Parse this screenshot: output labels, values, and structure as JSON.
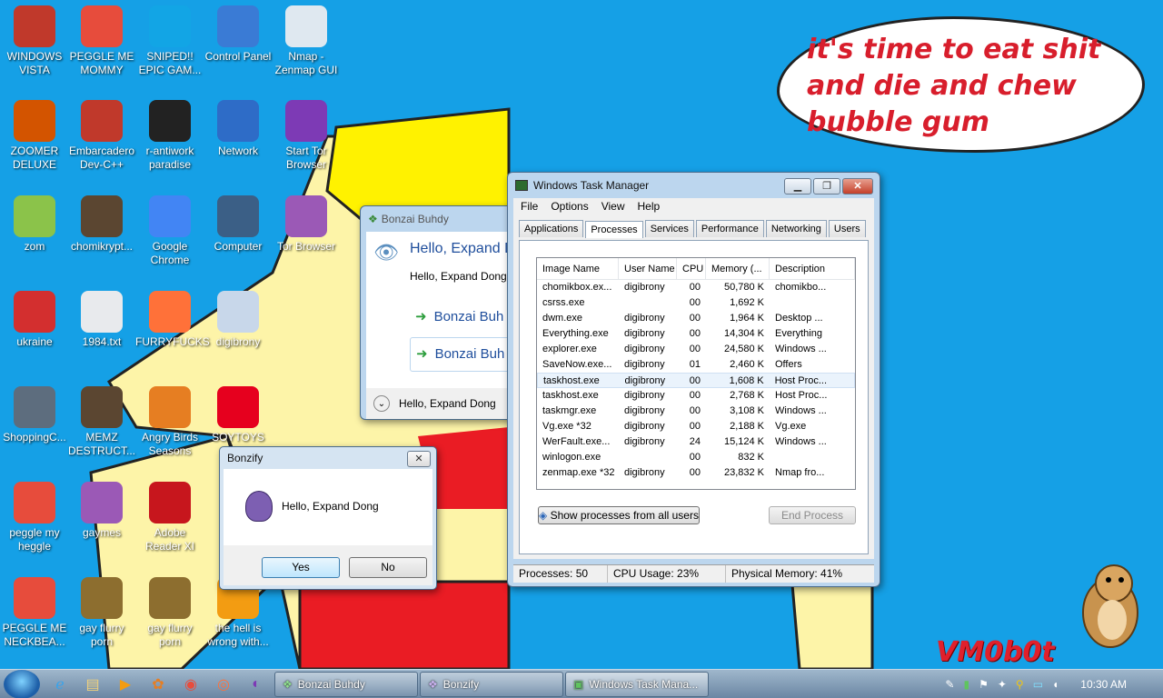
{
  "speech_text": "it's time to eat shit and die and chew bubble gum",
  "watermark": "VM0b0t",
  "desktop_icons": [
    {
      "label": "WINDOWS VISTA",
      "icon": "vista-icon",
      "color": "#c0392b"
    },
    {
      "label": "PEGGLE ME MOMMY",
      "icon": "peggle-icon",
      "color": "#e74c3c"
    },
    {
      "label": "SNIPED!! EPIC GAM...",
      "icon": "skype-icon",
      "color": "#12a5e5"
    },
    {
      "label": "Control Panel",
      "icon": "control-panel-icon",
      "color": "#3a7bd5"
    },
    {
      "label": "Nmap - Zenmap GUI",
      "icon": "eye-icon",
      "color": "#dfe8f0"
    },
    {
      "label": "ZOOMER DELUXE",
      "icon": "zoomer-icon",
      "color": "#d35400"
    },
    {
      "label": "Embarcadero Dev-C++",
      "icon": "devcpp-icon",
      "color": "#c0392b"
    },
    {
      "label": "r-antiwork paradise",
      "icon": "reddit-icon",
      "color": "#222222"
    },
    {
      "label": "Network",
      "icon": "network-icon",
      "color": "#2e6cc7"
    },
    {
      "label": "Start Tor Browser",
      "icon": "tor-icon",
      "color": "#7d3ab5"
    },
    {
      "label": "zom",
      "icon": "flower-icon",
      "color": "#8bc34a"
    },
    {
      "label": "chomikrypt...",
      "icon": "hourglass-icon",
      "color": "#5b4631"
    },
    {
      "label": "Google Chrome",
      "icon": "chrome-icon",
      "color": "#4285f4"
    },
    {
      "label": "Computer",
      "icon": "computer-icon",
      "color": "#3b5f86"
    },
    {
      "label": "Tor Browser",
      "icon": "tor-folder-icon",
      "color": "#9b59b6"
    },
    {
      "label": "ukraine",
      "icon": "radiation-icon",
      "color": "#d32f2f"
    },
    {
      "label": "1984.txt",
      "icon": "text-file-icon",
      "color": "#e8eaed"
    },
    {
      "label": "FURRYFUCKS",
      "icon": "firefox-icon",
      "color": "#ff7139"
    },
    {
      "label": "digibrony",
      "icon": "user-folder-icon",
      "color": "#c8d7ea"
    },
    {
      "label": "ShoppingC...",
      "icon": "flash-icon",
      "color": "#5d6d7e"
    },
    {
      "label": "MEMZ DESTRUCT...",
      "icon": "hourglass-icon",
      "color": "#5b4631"
    },
    {
      "label": "Angry Birds Seasons",
      "icon": "angry-birds-icon",
      "color": "#e67e22"
    },
    {
      "label": "SOYTOYS",
      "icon": "soytoys-icon",
      "color": "#e6001e"
    },
    {
      "label": "peggle my heggle",
      "icon": "peggle-icon",
      "color": "#e74c3c"
    },
    {
      "label": "gaymes",
      "icon": "games-folder-icon",
      "color": "#9b59b6"
    },
    {
      "label": "Adobe Reader XI",
      "icon": "adobe-icon",
      "color": "#c7161d"
    },
    {
      "label": "PEGGLE ME NECKBEA...",
      "icon": "peggle-icon",
      "color": "#e74c3c"
    },
    {
      "label": "gay flurry porn",
      "icon": "box-hamster-icon",
      "color": "#8d6e2f"
    },
    {
      "label": "gay flurry porn",
      "icon": "box-hamster-icon",
      "color": "#8d6e2f"
    },
    {
      "label": "the hell is wrong with...",
      "icon": "uc-browser-icon",
      "color": "#f39c12"
    }
  ],
  "bonzai": {
    "title": "Bonzai Buhdy",
    "heading": "Hello, Expand D",
    "text": "Hello, Expand Dong",
    "option1": "Bonzai Buh",
    "option2": "Bonzai Buh",
    "footer": "Hello, Expand Dong"
  },
  "bonzify": {
    "title": "Bonzify",
    "message": "Hello, Expand Dong",
    "yes": "Yes",
    "no": "No"
  },
  "task_manager": {
    "title": "Windows Task Manager",
    "menu": [
      "File",
      "Options",
      "View",
      "Help"
    ],
    "tabs": [
      "Applications",
      "Processes",
      "Services",
      "Performance",
      "Networking",
      "Users"
    ],
    "active_tab": "Processes",
    "columns": [
      "Image Name",
      "User Name",
      "CPU",
      "Memory (...",
      "Description"
    ],
    "rows": [
      [
        "chomikbox.ex...",
        "digibrony",
        "00",
        "50,780 K",
        "chomikbo..."
      ],
      [
        "csrss.exe",
        "",
        "00",
        "1,692 K",
        ""
      ],
      [
        "dwm.exe",
        "digibrony",
        "00",
        "1,964 K",
        "Desktop ..."
      ],
      [
        "Everything.exe",
        "digibrony",
        "00",
        "14,304 K",
        "Everything"
      ],
      [
        "explorer.exe",
        "digibrony",
        "00",
        "24,580 K",
        "Windows ..."
      ],
      [
        "SaveNow.exe...",
        "digibrony",
        "01",
        "2,460 K",
        "Offers"
      ],
      [
        "taskhost.exe",
        "digibrony",
        "00",
        "1,608 K",
        "Host Proc..."
      ],
      [
        "taskhost.exe",
        "digibrony",
        "00",
        "2,768 K",
        "Host Proc..."
      ],
      [
        "taskmgr.exe",
        "digibrony",
        "00",
        "3,108 K",
        "Windows ..."
      ],
      [
        "Vg.exe *32",
        "digibrony",
        "00",
        "2,188 K",
        "Vg.exe"
      ],
      [
        "WerFault.exe...",
        "digibrony",
        "24",
        "15,124 K",
        "Windows ..."
      ],
      [
        "winlogon.exe",
        "",
        "00",
        "832 K",
        ""
      ],
      [
        "zenmap.exe *32",
        "digibrony",
        "00",
        "23,832 K",
        "Nmap fro..."
      ]
    ],
    "show_all_label": "Show processes from all users",
    "end_process_label": "End Process",
    "status_processes": "Processes: 50",
    "status_cpu": "CPU Usage: 23%",
    "status_memory": "Physical Memory: 41%"
  },
  "taskbar": {
    "windows": [
      "Bonzai Buhdy",
      "Bonzify",
      "Windows Task Mana..."
    ],
    "clock": "10:30 AM"
  }
}
